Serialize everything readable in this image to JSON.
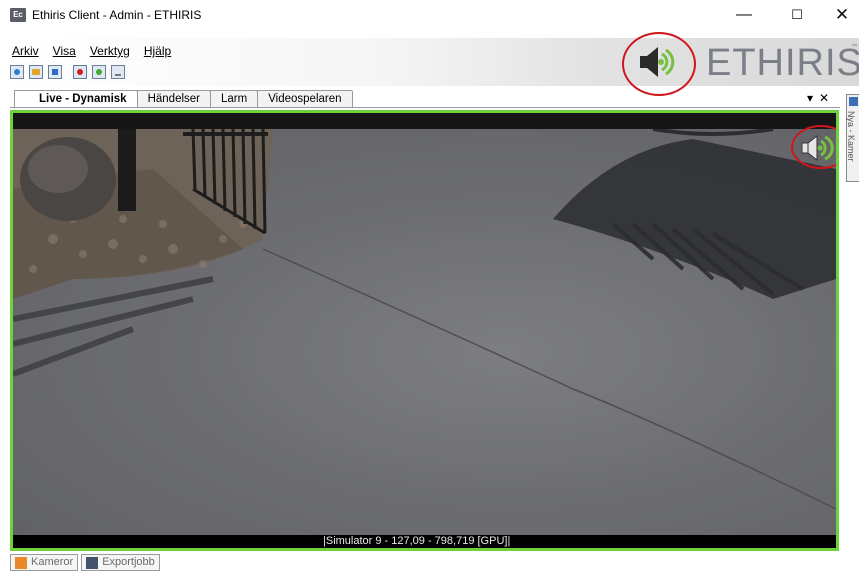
{
  "window": {
    "icon_text": "Ec",
    "title": "Ethiris Client - Admin - ETHIRIS",
    "minimize_glyph": "—",
    "maximize_glyph": "☐",
    "close_glyph": "✕"
  },
  "menu": [
    {
      "label": "Arkiv"
    },
    {
      "label": "Visa"
    },
    {
      "label": "Verktyg"
    },
    {
      "label": "Hjälp"
    }
  ],
  "toolbar": {
    "icons": [
      "settings-icon",
      "folder-icon",
      "sync-icon",
      "record-icon",
      "power-icon",
      "export-icon"
    ]
  },
  "brand": {
    "name": "ETHIRIS",
    "tm": "™",
    "speaker_icon": "speaker-icon"
  },
  "tabs": [
    {
      "label": "Live - Dynamisk",
      "active": true
    },
    {
      "label": "Händelser",
      "active": false
    },
    {
      "label": "Larm",
      "active": false
    },
    {
      "label": "Videospelaren",
      "active": false
    }
  ],
  "tab_controls": {
    "dropdown": "▾",
    "close": "✕"
  },
  "side_panel": {
    "label": "Nya - Kamer"
  },
  "video": {
    "caption": "|Simulator 9 - 127,09 - 798,719 [GPU]|",
    "audio_icon": "speaker-sound-icon",
    "border_color": "#6ed23a"
  },
  "bottom_tabs": [
    {
      "label": "Kameror",
      "icon": "camera-icon"
    },
    {
      "label": "Exportjobb",
      "icon": "export-job-icon"
    }
  ],
  "colors": {
    "highlight_circle": "#d2141d",
    "speaker_green": "#77c043"
  }
}
